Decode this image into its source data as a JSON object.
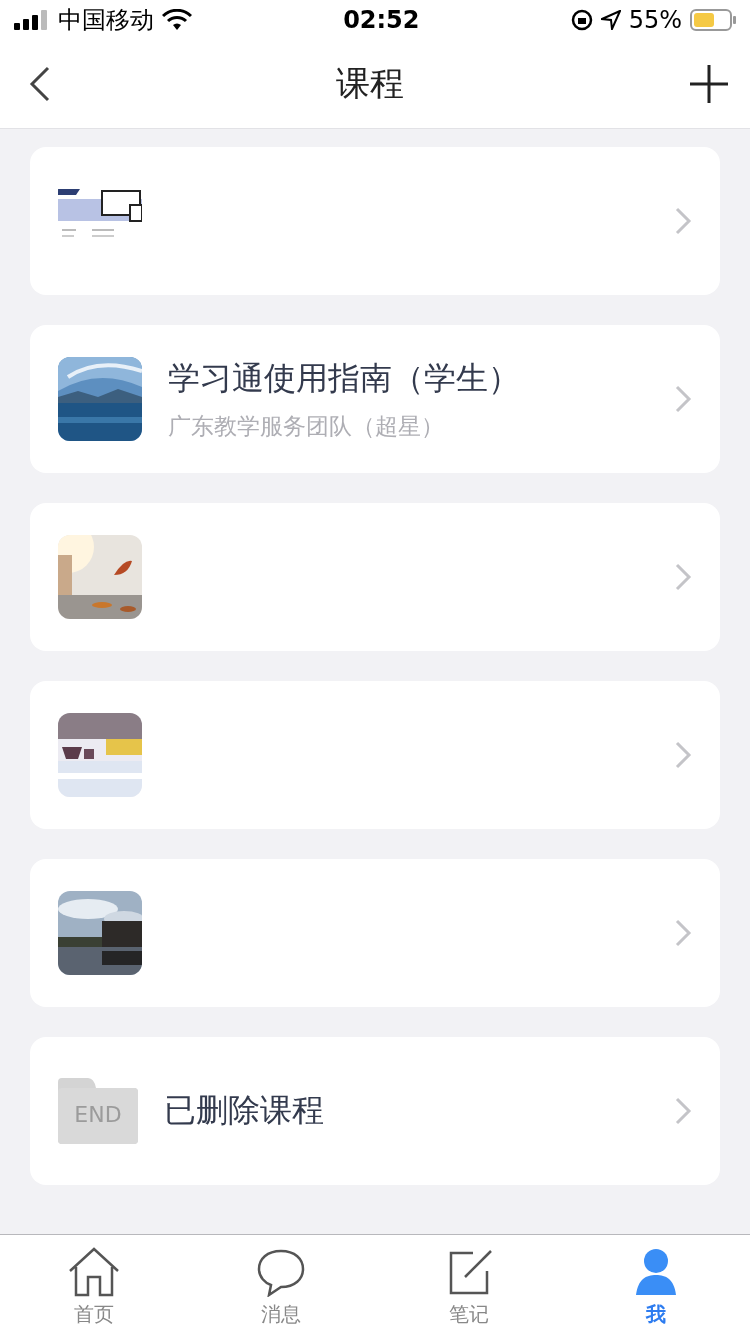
{
  "status_bar": {
    "carrier": "中国移动",
    "time": "02:52",
    "battery": "55%"
  },
  "nav": {
    "title": "课程"
  },
  "courses": [
    {
      "kind": "course"
    },
    {
      "kind": "course",
      "title": "学习通使用指南（学生）",
      "subtitle": "广东教学服务团队（超星）"
    },
    {
      "kind": "course"
    },
    {
      "kind": "course"
    },
    {
      "kind": "course"
    },
    {
      "kind": "deleted",
      "icon_text": "END",
      "title": "已删除课程"
    }
  ],
  "tabs": [
    {
      "label": "首页",
      "selected": false
    },
    {
      "label": "消息",
      "selected": false
    },
    {
      "label": "笔记",
      "selected": false
    },
    {
      "label": "我",
      "selected": true
    }
  ]
}
